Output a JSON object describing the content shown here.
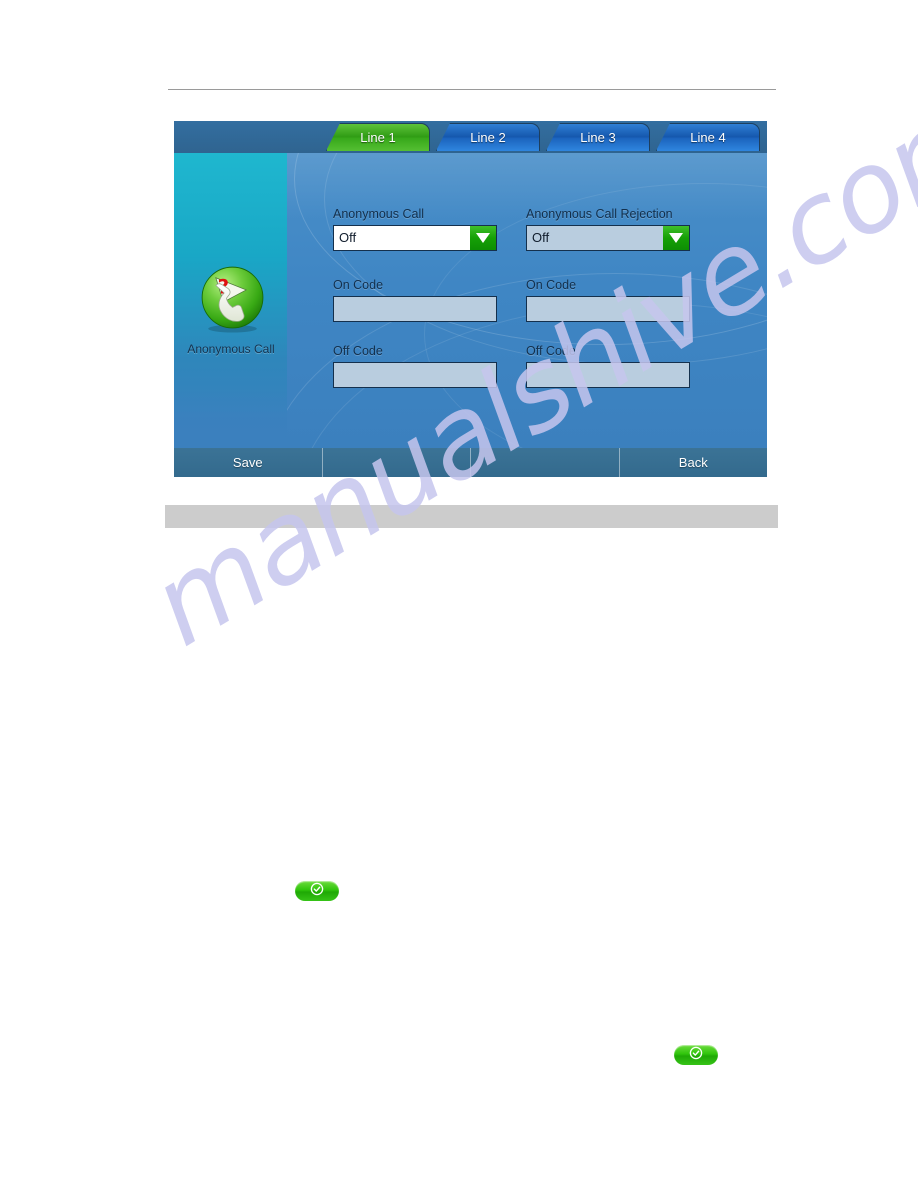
{
  "page": {
    "watermark": "manualshive.com",
    "background_color": "#ffffff",
    "rule_color": "#9a9a9a",
    "band_color": "#cccccc"
  },
  "device": {
    "tabs": [
      {
        "label": "Line 1",
        "active": true
      },
      {
        "label": "Line 2",
        "active": false
      },
      {
        "label": "Line 3",
        "active": false
      },
      {
        "label": "Line 4",
        "active": false
      }
    ],
    "sidebar": {
      "icon_name": "anonymous-call-icon",
      "label": "Anonymous Call"
    },
    "columns": [
      {
        "title": "Anonymous Call",
        "select": {
          "value": "Off",
          "state": "focused"
        },
        "fields": [
          {
            "label": "On Code",
            "value": ""
          },
          {
            "label": "Off Code",
            "value": ""
          }
        ]
      },
      {
        "title": "Anonymous Call Rejection",
        "select": {
          "value": "Off",
          "state": "normal"
        },
        "fields": [
          {
            "label": "On Code",
            "value": ""
          },
          {
            "label": "Off Code",
            "value": ""
          }
        ]
      }
    ],
    "softkeys": [
      {
        "label": "Save"
      },
      {
        "label": ""
      },
      {
        "label": ""
      },
      {
        "label": "Back"
      }
    ],
    "colors": {
      "active_tab_green": "#2f9c14",
      "inactive_tab_blue": "#1557ad",
      "screen_blue": "#3f86c4",
      "sidebar_teal": "#19a7c6",
      "softkey_bar": "#366d90",
      "input_fill": "#b9cddf",
      "label_text": "#13304d"
    }
  },
  "inline_icons": [
    {
      "name": "ok-confirm-pill",
      "glyph": "check-circle"
    },
    {
      "name": "ok-confirm-pill",
      "glyph": "check-circle"
    }
  ]
}
